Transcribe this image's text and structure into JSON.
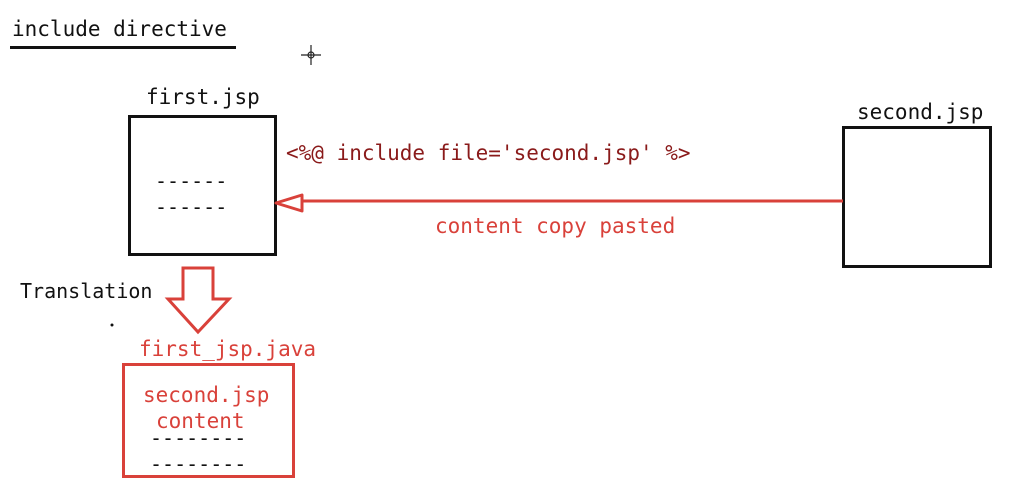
{
  "title": "include directive",
  "first_file": {
    "name": "first.jsp",
    "lines": [
      "------",
      "------"
    ]
  },
  "second_file": {
    "name": "second.jsp"
  },
  "directive": "<%@ include file='second.jsp' %>",
  "arrow_label": "content copy pasted",
  "translation_label": "Translation",
  "generated": {
    "name": "first_jsp.java",
    "content_lines": [
      "second.jsp",
      "content"
    ],
    "lines": [
      "--------",
      "--------"
    ]
  },
  "colors": {
    "black": "#111111",
    "red": "#d9413a",
    "dark_red": "#8a1a1a"
  }
}
